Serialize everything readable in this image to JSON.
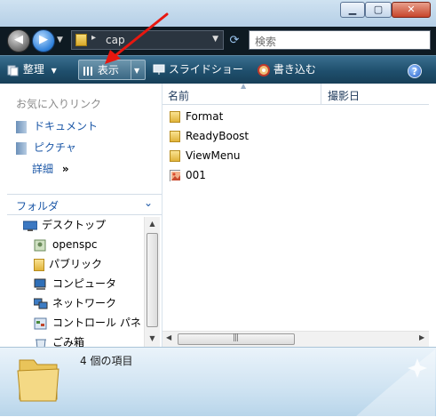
{
  "address": {
    "path_separator": "▸",
    "path": "cap",
    "search_placeholder": "検索"
  },
  "toolbar": {
    "organize": "整理",
    "view": "表示",
    "slideshow": "スライドショー",
    "burn": "書き込む",
    "help": "?"
  },
  "favorites": {
    "header": "お気に入りリンク",
    "items": [
      {
        "label": "ドキュメント"
      },
      {
        "label": "ピクチャ"
      }
    ],
    "more": "詳細",
    "more_chevron": "»"
  },
  "folders": {
    "header": "フォルダ",
    "items": [
      {
        "label": "デスクトップ"
      },
      {
        "label": "openspc"
      },
      {
        "label": "パブリック"
      },
      {
        "label": "コンピュータ"
      },
      {
        "label": "ネットワーク"
      },
      {
        "label": "コントロール パネ"
      },
      {
        "label": "ごみ箱"
      }
    ]
  },
  "filelist": {
    "columns": [
      {
        "label": "名前"
      },
      {
        "label": "撮影日"
      }
    ],
    "files": [
      {
        "name": "Format",
        "kind": "folder"
      },
      {
        "name": "ReadyBoost",
        "kind": "folder"
      },
      {
        "name": "ViewMenu",
        "kind": "folder"
      },
      {
        "name": "001",
        "kind": "image"
      }
    ]
  },
  "details": {
    "count_text": "4 個の項目"
  },
  "colors": {
    "toolbar": "#1f4f6d",
    "link": "#1a56a6",
    "annotation_arrow": "#e8170f"
  }
}
